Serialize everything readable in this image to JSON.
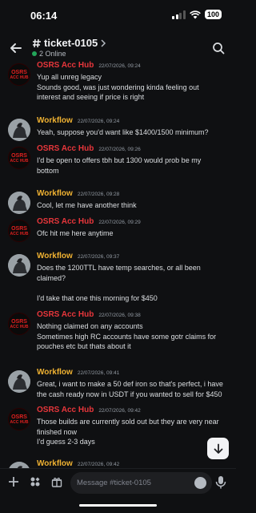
{
  "status": {
    "time": "06:14",
    "battery": "100"
  },
  "header": {
    "channel": "ticket-0105",
    "online": "2 Online"
  },
  "messages": [
    {
      "author": "OSRS Acc Hub",
      "role": "osrs",
      "time": "22/07/2026, 09:24",
      "lines": [
        "Yup all unreg legacy",
        "Sounds good, was just wondering kinda feeling out",
        "interest and seeing if price is right"
      ]
    },
    {
      "author": "Workflow",
      "role": "workflow",
      "time": "22/07/2026, 09:24",
      "lines": [
        "Yeah, suppose you'd want like $1400/1500 minimum?"
      ]
    },
    {
      "author": "OSRS Acc Hub",
      "role": "osrs",
      "time": "22/07/2026, 09:26",
      "lines": [
        "I'd be open to offers tbh but 1300 would prob be my",
        "bottom"
      ]
    },
    {
      "author": "Workflow",
      "role": "workflow",
      "time": "22/07/2026, 09:28",
      "lines": [
        "Cool, let me have another think"
      ]
    },
    {
      "author": "OSRS Acc Hub",
      "role": "osrs",
      "time": "22/07/2026, 09:29",
      "lines": [
        "Ofc hit me here anytime"
      ]
    },
    {
      "author": "Workflow",
      "role": "workflow",
      "time": "22/07/2026, 09:37",
      "lines": [
        "Does the 1200TTL have temp searches, or all been",
        "claimed?",
        "",
        "I'd take that one this morning for $450"
      ]
    },
    {
      "author": "OSRS Acc Hub",
      "role": "osrs",
      "time": "22/07/2026, 09:38",
      "lines": [
        "Nothing claimed on any accounts",
        "Sometimes high RC accounts have some gotr claims for",
        "pouches etc but thats about it"
      ]
    },
    {
      "author": "Workflow",
      "role": "workflow",
      "time": "22/07/2026, 09:41",
      "lines": [
        "Great, i want to make a 50 def iron so that's perfect, i have",
        "the cash ready now in USDT if you wanted to sell for $450"
      ]
    },
    {
      "author": "OSRS Acc Hub",
      "role": "osrs",
      "time": "22/07/2026, 09:42",
      "lines": [
        "Those builds are currently sold out but they are very near",
        "finished now",
        "I'd guess 2-3 days"
      ]
    },
    {
      "author": "Workflow",
      "role": "workflow",
      "time": "22/07/2026, 09:42",
      "lines": []
    }
  ],
  "avatar_osrs": {
    "line1": "OSRS",
    "line2": "ACC HUB"
  },
  "composer": {
    "placeholder": "Message #ticket-0105"
  },
  "colors": {
    "osrs": "#e7363b",
    "workflow": "#f0b232",
    "online": "#23a55a",
    "background": "#0f1012"
  },
  "icons": {
    "back": "arrow-left-icon",
    "search": "search-icon",
    "plus": "plus-icon",
    "apps": "apps-icon",
    "gift": "gift-icon",
    "emoji": "emoji-icon",
    "mic": "microphone-icon",
    "jump": "arrow-down-icon"
  }
}
